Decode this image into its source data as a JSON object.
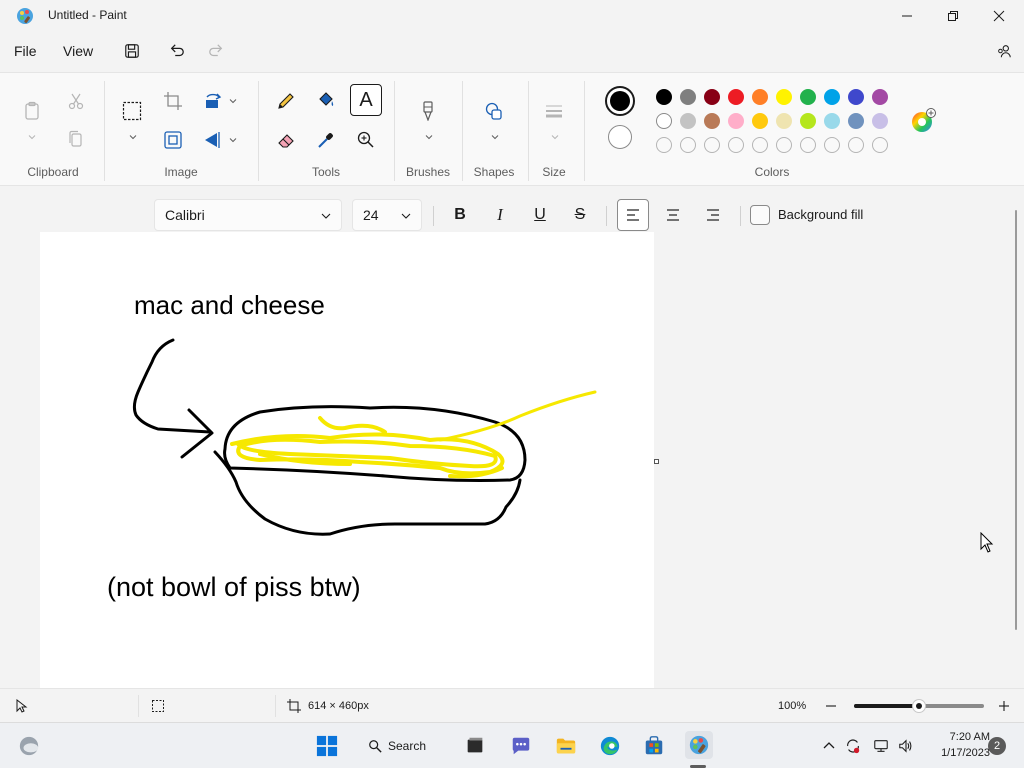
{
  "window": {
    "title": "Untitled - Paint"
  },
  "menu": {
    "file": "File",
    "view": "View"
  },
  "ribbon": {
    "groups": {
      "clipboard": "Clipboard",
      "image": "Image",
      "tools": "Tools",
      "brushes": "Brushes",
      "shapes": "Shapes",
      "size": "Size",
      "colors": "Colors"
    },
    "text_tool_glyph": "A",
    "colors": {
      "primary": "#000000",
      "secondary": "#ffffff",
      "row1": [
        "#000000",
        "#7f7f7f",
        "#880015",
        "#ed1c24",
        "#ff7f27",
        "#fff200",
        "#22b14c",
        "#00a2e8",
        "#3f48cc",
        "#a349a4"
      ],
      "row2": [
        "#ffffff",
        "#c3c3c3",
        "#b97a57",
        "#ffaec9",
        "#ffc90e",
        "#efe4b0",
        "#b5e61d",
        "#99d9ea",
        "#7092be",
        "#c8bfe7"
      ],
      "row3_count": 10
    }
  },
  "text_format": {
    "font": "Calibri",
    "size": "24",
    "bold": "B",
    "italic": "I",
    "underline": "U",
    "strike": "S",
    "background_fill": "Background fill"
  },
  "canvas": {
    "text_1": "mac and cheese",
    "text_2": "(not bowl of piss btw)"
  },
  "status": {
    "canvas_size": "614 × 460px",
    "zoom": "100%",
    "zoom_level": 0.5
  },
  "taskbar": {
    "search": "Search",
    "time": "7:20 AM",
    "date": "1/17/2023",
    "notifications": "2"
  }
}
